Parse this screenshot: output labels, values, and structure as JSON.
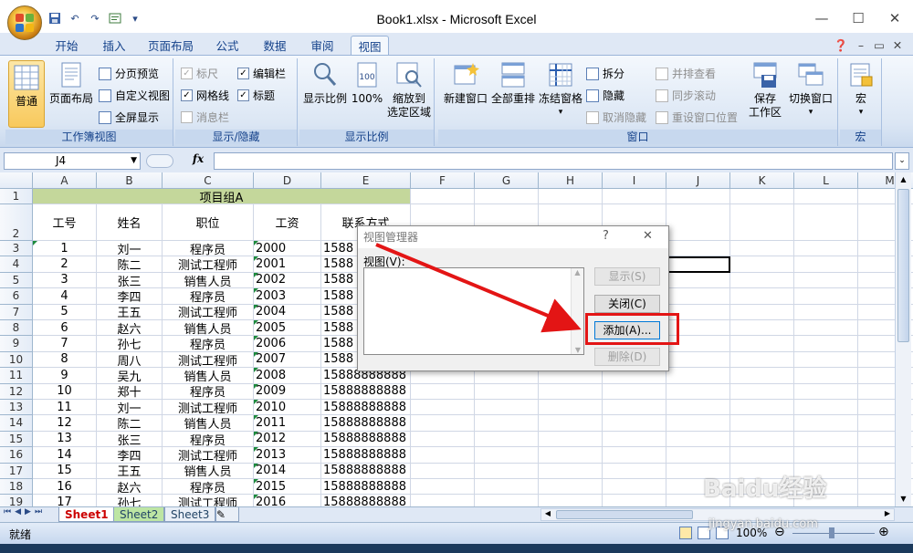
{
  "window": {
    "title": "Book1.xlsx - Microsoft Excel",
    "controls": {
      "minimize": "—",
      "restore": "☐",
      "close": "✕"
    }
  },
  "qat": {
    "save_icon": "save-icon",
    "undo": "↶",
    "redo": "↷",
    "sep": "▾"
  },
  "ribbon_tabs": [
    "开始",
    "插入",
    "页面布局",
    "公式",
    "数据",
    "审阅",
    "视图"
  ],
  "active_tab": "视图",
  "ribbon": {
    "workbook_views": {
      "label": "工作簿视图",
      "normal": "普通",
      "page_layout": "页面布局",
      "page_break": "分页预览",
      "custom_views": "自定义视图",
      "full_screen": "全屏显示"
    },
    "show_hide": {
      "label": "显示/隐藏",
      "ruler": "标尺",
      "gridlines": "网格线",
      "message_bar": "消息栏",
      "formula_bar": "编辑栏",
      "headings": "标题"
    },
    "zoom": {
      "label": "显示比例",
      "zoom": "显示比例",
      "hundred": "100%",
      "zoom_sel_1": "缩放到",
      "zoom_sel_2": "选定区域"
    },
    "window_group": {
      "label": "窗口",
      "new_window": "新建窗口",
      "arrange_all": "全部重排",
      "freeze_1": "冻结窗格",
      "split": "拆分",
      "hide": "隐藏",
      "unhide": "取消隐藏",
      "side_by_side": "并排查看",
      "sync_scroll": "同步滚动",
      "reset_pos": "重设窗口位置",
      "save_ws_1": "保存",
      "save_ws_2": "工作区",
      "switch_1": "切换窗口"
    },
    "macros": {
      "label": "宏",
      "macro": "宏"
    }
  },
  "formula_bar": {
    "name_box": "J4",
    "fx": "fx",
    "value": ""
  },
  "columns": [
    "A",
    "B",
    "C",
    "D",
    "E",
    "F",
    "G",
    "H",
    "I",
    "J",
    "K",
    "L",
    "M"
  ],
  "merged_title": "项目组A",
  "headers": [
    "工号",
    "姓名",
    "职位",
    "工资",
    "联系方式"
  ],
  "rows": [
    {
      "r": "3",
      "id": "1",
      "name": "刘一",
      "pos": "程序员",
      "sal": "2000",
      "tel": "1588"
    },
    {
      "r": "4",
      "id": "2",
      "name": "陈二",
      "pos": "测试工程师",
      "sal": "2001",
      "tel": "1588"
    },
    {
      "r": "5",
      "id": "3",
      "name": "张三",
      "pos": "销售人员",
      "sal": "2002",
      "tel": "1588"
    },
    {
      "r": "6",
      "id": "4",
      "name": "李四",
      "pos": "程序员",
      "sal": "2003",
      "tel": "1588"
    },
    {
      "r": "7",
      "id": "5",
      "name": "王五",
      "pos": "测试工程师",
      "sal": "2004",
      "tel": "1588"
    },
    {
      "r": "8",
      "id": "6",
      "name": "赵六",
      "pos": "销售人员",
      "sal": "2005",
      "tel": "1588"
    },
    {
      "r": "9",
      "id": "7",
      "name": "孙七",
      "pos": "程序员",
      "sal": "2006",
      "tel": "1588"
    },
    {
      "r": "10",
      "id": "8",
      "name": "周八",
      "pos": "测试工程师",
      "sal": "2007",
      "tel": "1588"
    },
    {
      "r": "11",
      "id": "9",
      "name": "吴九",
      "pos": "销售人员",
      "sal": "2008",
      "tel": "15888888888"
    },
    {
      "r": "12",
      "id": "10",
      "name": "郑十",
      "pos": "程序员",
      "sal": "2009",
      "tel": "15888888888"
    },
    {
      "r": "13",
      "id": "11",
      "name": "刘一",
      "pos": "测试工程师",
      "sal": "2010",
      "tel": "15888888888"
    },
    {
      "r": "14",
      "id": "12",
      "name": "陈二",
      "pos": "销售人员",
      "sal": "2011",
      "tel": "15888888888"
    },
    {
      "r": "15",
      "id": "13",
      "name": "张三",
      "pos": "程序员",
      "sal": "2012",
      "tel": "15888888888"
    },
    {
      "r": "16",
      "id": "14",
      "name": "李四",
      "pos": "测试工程师",
      "sal": "2013",
      "tel": "15888888888"
    },
    {
      "r": "17",
      "id": "15",
      "name": "王五",
      "pos": "销售人员",
      "sal": "2014",
      "tel": "15888888888"
    },
    {
      "r": "18",
      "id": "16",
      "name": "赵六",
      "pos": "程序员",
      "sal": "2015",
      "tel": "15888888888"
    },
    {
      "r": "19",
      "id": "17",
      "name": "孙七",
      "pos": "测试工程师",
      "sal": "2016",
      "tel": "15888888888"
    }
  ],
  "row_labels": {
    "r1": "1",
    "r2": "2"
  },
  "sheet_tabs": [
    "Sheet1",
    "Sheet2",
    "Sheet3"
  ],
  "status": {
    "ready": "就绪",
    "zoom": "100%"
  },
  "dialog": {
    "title": "视图管理器",
    "help": "?",
    "close": "✕",
    "views_label": "视图(V):",
    "show_btn": "显示(S)",
    "close_btn": "关闭(C)",
    "add_btn": "添加(A)...",
    "delete_btn": "删除(D)"
  },
  "watermark": {
    "logo": "Baidu经验",
    "url": "jingyan.baidu.com"
  },
  "colors": {
    "title_fill": "#c4d79b",
    "accent": "#15428b",
    "highlight": "#e31515"
  }
}
